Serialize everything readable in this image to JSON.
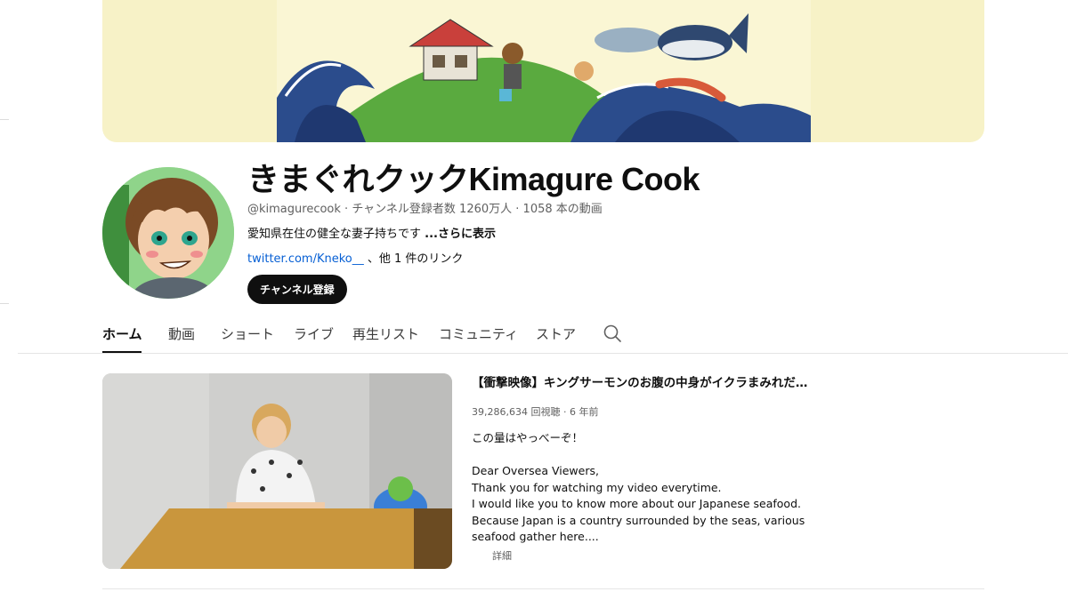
{
  "channel": {
    "name": "きまぐれクックKimagure Cook",
    "handle": "@kimagurecook",
    "subscribers": "チャンネル登録者数 1260万人",
    "video_count": "1058 本の動画",
    "description": "愛知県在住の健全な妻子持ちです",
    "more_label": "...さらに表示",
    "link_text": "twitter.com/Kneko__",
    "link_suffix": "、他 1 件のリンク",
    "subscribe_label": "チャンネル登録"
  },
  "tabs": [
    {
      "label": "ホーム",
      "active": true
    },
    {
      "label": "動画"
    },
    {
      "label": "ショート"
    },
    {
      "label": "ライブ"
    },
    {
      "label": "再生リスト"
    },
    {
      "label": "コミュニティ"
    },
    {
      "label": "ストア"
    }
  ],
  "featured_video": {
    "title": "【衝撃映像】キングサーモンのお腹の中身がイクラまみれだ…",
    "views": "39,286,634 回視聴",
    "age": "6 年前",
    "description_lines": [
      "この量はやっべーぞ！",
      "",
      "Dear Oversea Viewers,",
      "Thank you for watching my video everytime.",
      "I would like you to know more about our Japanese seafood.",
      "Because Japan is a country surrounded by the seas, various",
      "seafood gather here...."
    ],
    "details_label": "詳細"
  },
  "icons": {
    "search": "search-icon"
  },
  "colors": {
    "subscribe_bg": "#0f0f0f",
    "link": "#065fd4",
    "banner_bg": "#f7f2c7"
  }
}
